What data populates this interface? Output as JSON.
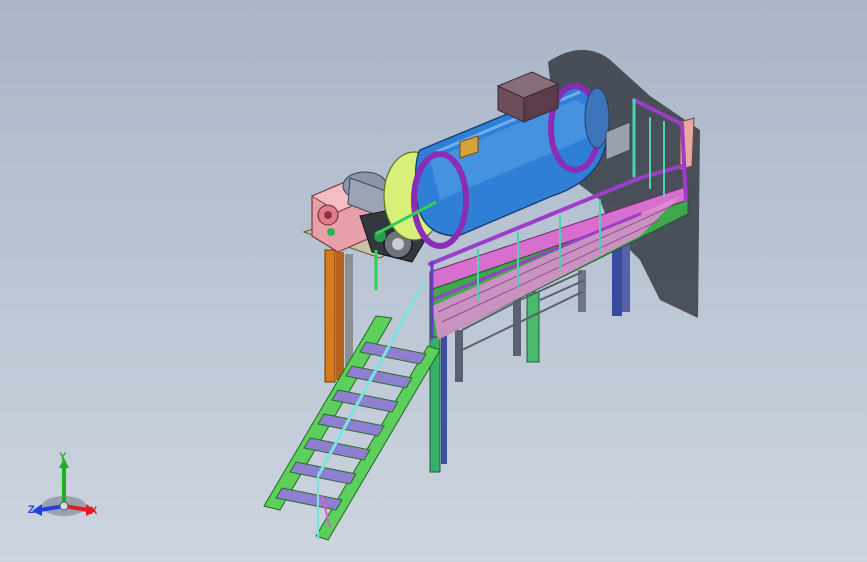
{
  "colors": {
    "background_top": "#a9b6c8",
    "background_bottom": "#cdd5df",
    "drum_body": "#2f7fd6",
    "drum_flange": "#8a2db5",
    "gearbox": "#e8a0a8",
    "platform_deck": "#d86fcf",
    "handrail": "#9b3ec9",
    "stair_stringer": "#5ccf5c",
    "support_column": "#d77a1d",
    "axis_x": "#e02020",
    "axis_y": "#20b020",
    "axis_z": "#2040e0"
  },
  "triad": {
    "x_label": "X",
    "y_label": "Y",
    "z_label": "Z"
  }
}
